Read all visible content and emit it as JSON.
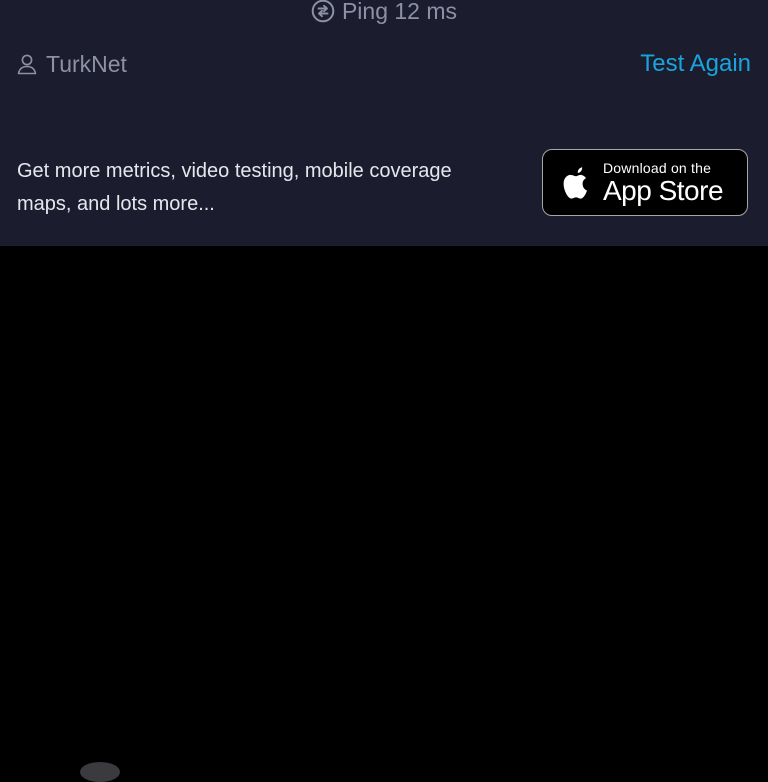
{
  "ping": {
    "icon": "speedtest-logo-icon",
    "label": "Ping 12 ms"
  },
  "provider": {
    "icon": "person-icon",
    "name": "TurkNet"
  },
  "actions": {
    "test_again": "Test Again"
  },
  "promo": {
    "text": "Get more metrics, video testing, mobile coverage maps, and lots more..."
  },
  "app_store": {
    "icon": "apple-icon",
    "line1": "Download on the",
    "line2": "App Store"
  },
  "colors": {
    "panel_bg": "#1b1c2d",
    "page_bg": "#000000",
    "muted_text": "#8e91a4",
    "accent": "#1aa3dc",
    "body_text": "#e6e7ee"
  }
}
